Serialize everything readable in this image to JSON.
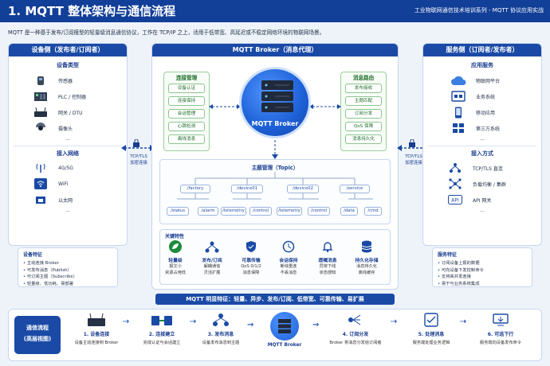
{
  "header": {
    "title": "1. MQTT 整体架构与通信流程",
    "series": "工业物联网通信技术培训系列 - MQTT 协议应用实战"
  },
  "intro": "MQTT 是一种基于发布/订阅模型的轻量级消息通信协议，工作在 TCP/IP 之上，适用于低带宽、高延迟或不稳定网络环境的物联网场景。",
  "left": {
    "title": "设备侧（发布者/订阅者）",
    "device_types_title": "设备类型",
    "devices": [
      {
        "icon": "sensor-icon",
        "label": "传感器"
      },
      {
        "icon": "plc-icon",
        "label": "PLC / 控制器"
      },
      {
        "icon": "gateway-icon",
        "label": "网关 / DTU"
      },
      {
        "icon": "camera-icon",
        "label": "摄像头"
      }
    ],
    "more": "...",
    "network_title": "接入网络",
    "networks": [
      {
        "icon": "antenna-icon",
        "label": "4G/5G"
      },
      {
        "icon": "wifi-icon",
        "label": "WiFi"
      },
      {
        "icon": "ethernet-icon",
        "label": "以太网"
      }
    ],
    "features_title": "设备特征",
    "features": [
      "主动连接 Broker",
      "可发布消息（Publish）",
      "可订阅主题（Subscribe）",
      "轻量级、低功耗、易部署"
    ]
  },
  "left_link": {
    "line1": "TCP/TLS",
    "line2": "加密连接"
  },
  "right_link": {
    "line1": "TCP/TLS",
    "line2": "加密连接"
  },
  "broker": {
    "title": "MQTT Broker（消息代理）",
    "label": "MQTT Broker",
    "conn_title": "连接管理",
    "conn_items": [
      "设备认证",
      "连接保持",
      "会话管理",
      "心跳检测",
      "离线消息"
    ],
    "route_title": "消息路由",
    "route_items": [
      "发布接收",
      "主题匹配",
      "订阅分发",
      "QoS 保障",
      "消息持久化"
    ],
    "topic_title": "主题管理（Topic）",
    "topic_l1": [
      "/factory",
      "/device01",
      "/device02",
      "/service"
    ],
    "topic_l2": [
      "/status",
      "/alarm",
      "/telemetry",
      "/control",
      "/telemetry",
      "/control",
      "/data",
      "/cmd"
    ],
    "key_title": "关键特性",
    "keys": [
      {
        "icon": "leaf-icon",
        "name": "轻量级",
        "d1": "报文小",
        "d2": "资源占用低"
      },
      {
        "icon": "pubsub-icon",
        "name": "发布/订阅",
        "d1": "解耦通信",
        "d2": "灵活扩展"
      },
      {
        "icon": "shield-icon",
        "name": "可靠传输",
        "d1": "QoS 0/1/2",
        "d2": "消息保障"
      },
      {
        "icon": "clock-icon",
        "name": "会话保持",
        "d1": "断线重连",
        "d2": "不丢消息"
      },
      {
        "icon": "bell-icon",
        "name": "遗嘱消息",
        "d1": "异常下线",
        "d2": "状态感知"
      },
      {
        "icon": "database-icon",
        "name": "持久化存储",
        "d1": "消息持久化",
        "d2": "离线缓存"
      }
    ]
  },
  "right": {
    "title": "服务侧（订阅者/发布者）",
    "apps_title": "应用服务",
    "apps": [
      {
        "icon": "cloud-icon",
        "label": "物联网平台"
      },
      {
        "icon": "server-app-icon",
        "label": "业务系统"
      },
      {
        "icon": "mobile-icon",
        "label": "移动应用"
      },
      {
        "icon": "third-party-icon",
        "label": "第三方系统"
      }
    ],
    "more": "...",
    "access_title": "接入方式",
    "access": [
      {
        "icon": "network-icon",
        "label": "TCP/TLS 直连"
      },
      {
        "icon": "cluster-icon",
        "label": "负载均衡 / 集群"
      },
      {
        "icon": "api-icon",
        "label": "API 网关"
      }
    ],
    "features_title": "服务特征",
    "features": [
      "订阅设备上报的数据",
      "可向设备下发控制命令",
      "支持高并发连接",
      "易于与业务系统集成"
    ]
  },
  "banner2": "MQTT 明显特征：轻量、异步、发布/订阅、低带宽、可靠传输、易扩展",
  "flow": {
    "title1": "通信流程",
    "title2": "(高层视图)",
    "steps": [
      {
        "name": "1. 设备连接",
        "desc": "设备主动连接到 Broker"
      },
      {
        "name": "2. 连接建立",
        "desc": "完成认证与会话建立"
      },
      {
        "name": "3. 发布消息",
        "desc": "设备发布消息到主题"
      },
      {
        "name": "",
        "desc": "MQTT Broker"
      },
      {
        "name": "4. 订阅分发",
        "desc": "Broker 将消息分发给订阅者"
      },
      {
        "name": "5. 处理消息",
        "desc": "服务端处理业务逻辑"
      },
      {
        "name": "6. 可选下行",
        "desc": "服务端向设备发布命令"
      }
    ]
  }
}
